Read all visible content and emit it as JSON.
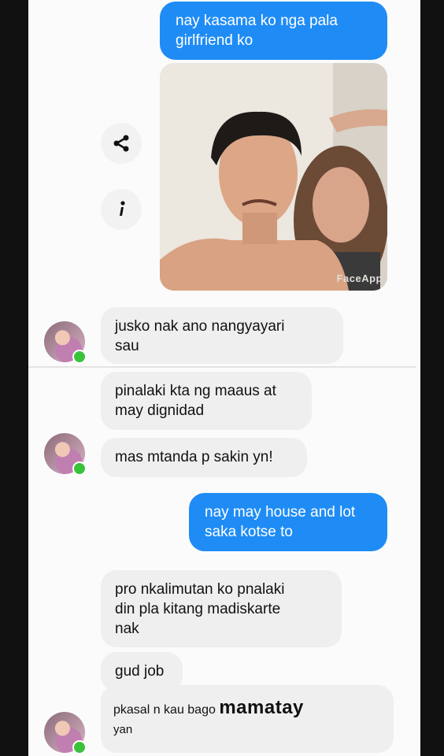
{
  "messages": [
    {
      "id": "m1",
      "dir": "out",
      "text": "nay kasama ko nga pala\ngirlfriend ko"
    },
    {
      "id": "m2",
      "dir": "in",
      "text": "jusko nak ano nangyayari\nsau"
    },
    {
      "id": "m3",
      "dir": "in",
      "text": "pinalaki kta ng maaus at\nmay dignidad"
    },
    {
      "id": "m4",
      "dir": "in",
      "text": "mas mtanda p sakin yn!"
    },
    {
      "id": "m5",
      "dir": "out",
      "text": "nay may house and lot\nsaka kotse to"
    },
    {
      "id": "m6",
      "dir": "in",
      "text": "pro nkalimutan ko pnalaki\ndin pla kitang madiskarte\nnak"
    },
    {
      "id": "m7",
      "dir": "in",
      "text": "gud job"
    }
  ],
  "last_message": {
    "part1": "pkasal n kau bago ",
    "part2": "mamatay",
    "part3": "yan"
  },
  "photo_watermark": "FaceApp",
  "icons": {
    "share": "share-icon",
    "info": "info-icon"
  },
  "colors": {
    "outgoing": "#1f8cf5",
    "incoming": "#efefef",
    "online": "#3ac23a"
  }
}
